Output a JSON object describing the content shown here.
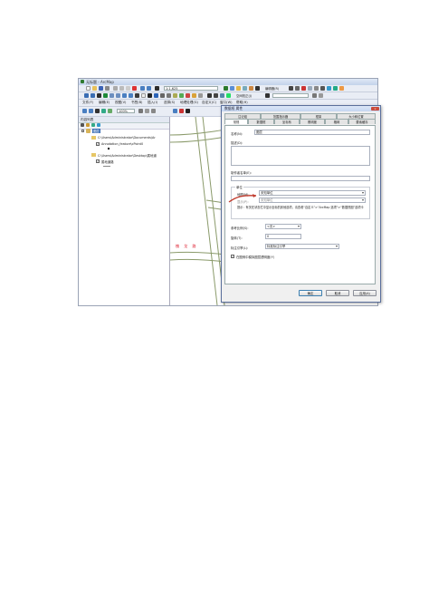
{
  "window": {
    "title": "无标题 - ArcMap"
  },
  "toolbar": {
    "scale_value": "1:1,625",
    "editor_label": "编辑器(R)",
    "georef_label": "空间校正(J)"
  },
  "menu": {
    "items": [
      "文件(F)",
      "编辑(E)",
      "视图(V)",
      "书签(B)",
      "插入(I)",
      "选择(S)",
      "地理处理(G)",
      "自定义(C)",
      "窗口(W)",
      "帮助(H)"
    ]
  },
  "toc": {
    "title": "内容列表",
    "zoom": "100%",
    "items": [
      "图层",
      "C:\\Users\\Administrator\\Documents\\Ar",
      "Annotation_feature\\cPoint0",
      "C:\\Users\\Administrator\\Desktop\\属地道",
      "属地道路"
    ]
  },
  "map": {
    "road_label_1": "槐 龙 路",
    "road_label_2": "路"
  },
  "dialog": {
    "title": "数据框 属性",
    "close_label": "×",
    "tabs_top": [
      "注记组",
      "范围指示器",
      "框架",
      "大小和位置"
    ],
    "tabs_bottom": [
      "常规",
      "数据框",
      "坐标系",
      "照明度",
      "格网",
      "要素缓存"
    ],
    "name_label": "名称(N):",
    "name_value": "图层",
    "desc_label": "描述(D):",
    "credits_label": "制作者名单(E):",
    "units_group_label": "单位",
    "map_units_label": "地图(M):",
    "map_units_value": "未知单位",
    "display_units_label": "显示(P):",
    "display_units_value": "未知单位",
    "hint_text": "提示：有关在状态栏中显示坐标的其他选项，请查看“自定义”>“ArcMap 选项”>“数据视图”选项卡",
    "ref_scale_label": "参考比例(S):",
    "ref_scale_value": "<无>",
    "rotation_label": "旋转(T):",
    "rotation_value": "0",
    "label_engine_label": "标注引擎(L):",
    "label_engine_value": "标准标注引擎",
    "simulate_label": "在图例中模拟图层透明度(Y)",
    "ok_label": "确定",
    "cancel_label": "取消",
    "apply_label": "应用(A)"
  }
}
